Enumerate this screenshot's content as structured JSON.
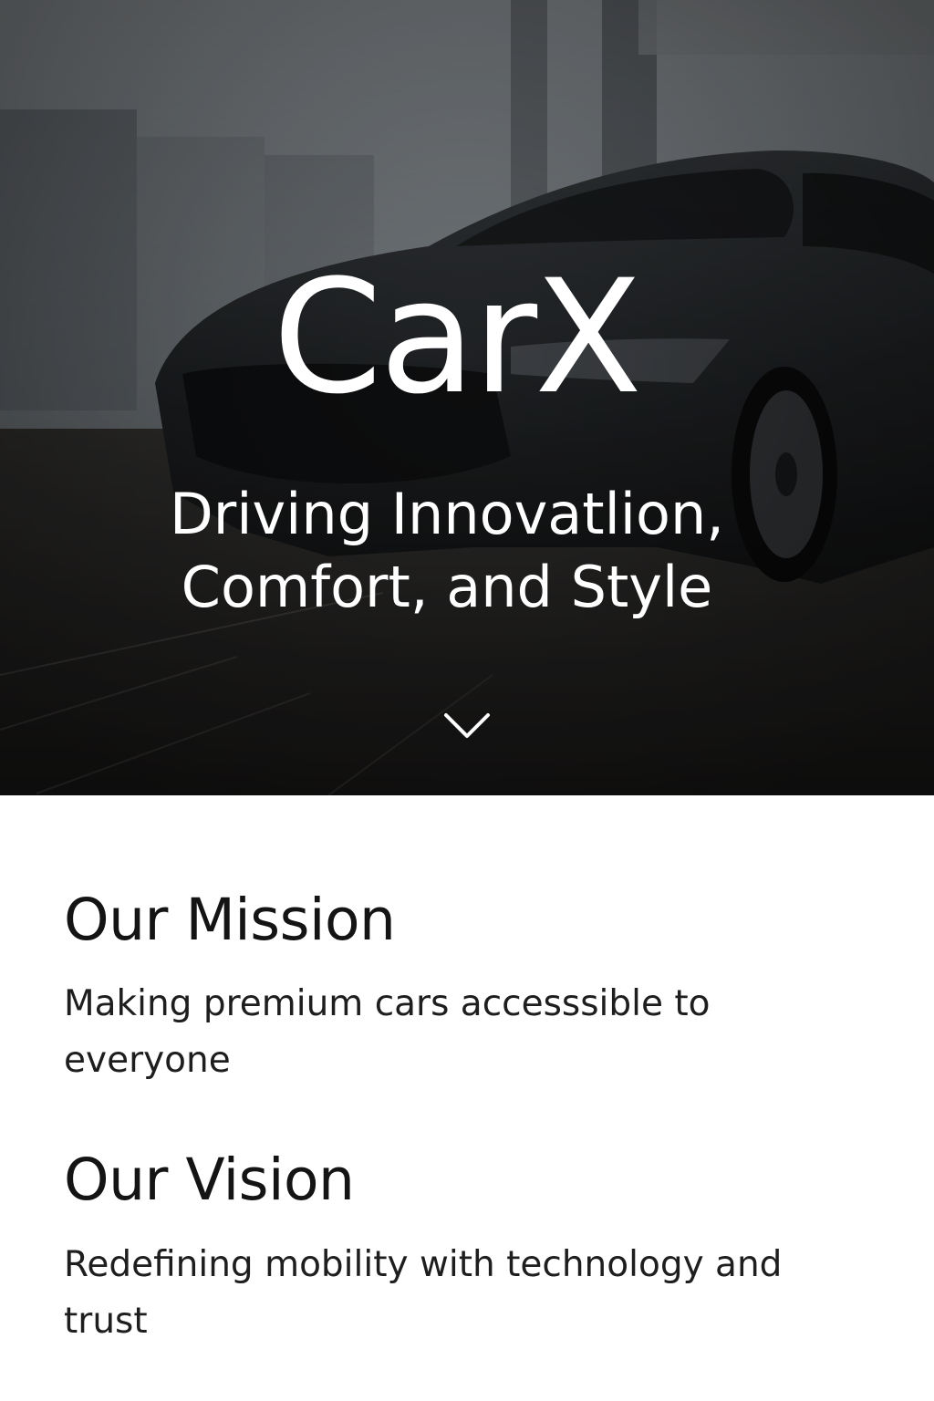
{
  "hero": {
    "brand": "CarX",
    "tagline_line1": "Driving Innovatlion,",
    "tagline_line2": "Comfort, and Style",
    "scroll_icon": "chevron-down-icon",
    "background_image": "dark sedan in showroom"
  },
  "mission": {
    "title": "Our Mission",
    "text": "Making premium cars accesssible to everyone"
  },
  "vision": {
    "title": "Our Vision",
    "text": "Redefining mobility with technology and trust"
  },
  "colors": {
    "hero_text": "#ffffff",
    "heading": "#141414",
    "body_text": "#1e1e1e",
    "page_background": "#ffffff"
  }
}
